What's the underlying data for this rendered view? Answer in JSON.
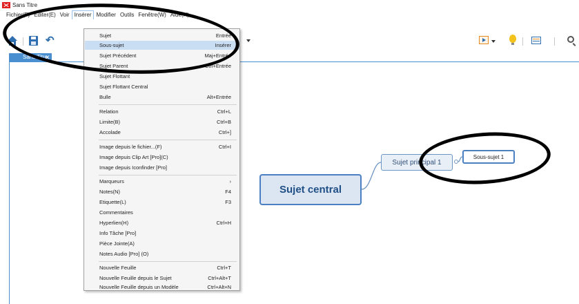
{
  "window": {
    "title": "Sans Titre"
  },
  "menubar": {
    "items": [
      {
        "label": "Fichier(F)"
      },
      {
        "label": "Editer(E)"
      },
      {
        "label": "Voir"
      },
      {
        "label": "Insérer"
      },
      {
        "label": "Modifier"
      },
      {
        "label": "Outils"
      },
      {
        "label": "Fenêtre(W)"
      },
      {
        "label": "Aide(H)"
      }
    ]
  },
  "tab": {
    "label": "Sans Titre",
    "close": "✕"
  },
  "insert_menu": {
    "items": [
      {
        "label": "Sujet",
        "shortcut": "Entrée"
      },
      {
        "label": "Sous-sujet",
        "shortcut": "Insérer"
      },
      {
        "label": "Sujet Précédent",
        "shortcut": "Maj+Entrée"
      },
      {
        "label": "Sujet Parent",
        "shortcut": "Ctrl+Entrée"
      },
      {
        "label": "Sujet Flottant",
        "shortcut": ""
      },
      {
        "label": "Sujet Flottant Central",
        "shortcut": ""
      },
      {
        "label": "Bulle",
        "shortcut": "Alt+Entrée"
      },
      {
        "label": "Relation",
        "shortcut": "Ctrl+L"
      },
      {
        "label": "Limite(B)",
        "shortcut": "Ctrl+B"
      },
      {
        "label": "Accolade",
        "shortcut": "Ctrl+]"
      },
      {
        "label": "Image depuis le fichier...(F)",
        "shortcut": "Ctrl+I"
      },
      {
        "label": "Image depuis Clip Art [Pro](C)",
        "shortcut": ""
      },
      {
        "label": "Image depuis Iconfinder [Pro]",
        "shortcut": ""
      },
      {
        "label": "Marqueurs",
        "shortcut": "›"
      },
      {
        "label": "Notes(N)",
        "shortcut": "F4"
      },
      {
        "label": "Etiquette(L)",
        "shortcut": "F3"
      },
      {
        "label": "Commentaires",
        "shortcut": ""
      },
      {
        "label": "Hyperlien(H)",
        "shortcut": "Ctrl+H"
      },
      {
        "label": "Info Tâche [Pro]",
        "shortcut": ""
      },
      {
        "label": "Pièce Jointe(A)",
        "shortcut": ""
      },
      {
        "label": "Notes Audio [Pro] (O)",
        "shortcut": ""
      },
      {
        "label": "Nouvelle Feuille",
        "shortcut": "Ctrl+T"
      },
      {
        "label": "Nouvelle Feuille depuis le Sujet",
        "shortcut": "Ctrl+Alt+T"
      },
      {
        "label": "Nouvelle Feuille depuis un Modèle",
        "shortcut": "Ctrl+Alt+N"
      }
    ]
  },
  "mindmap": {
    "central": "Sujet central",
    "main": "Sujet principal 1",
    "sub": "Sous-sujet 1"
  },
  "colors": {
    "accent": "#4a8fd0",
    "central_fill": "#dce6f2",
    "central_border": "#4a7fc1",
    "menu_highlight": "#c9ddf3"
  }
}
